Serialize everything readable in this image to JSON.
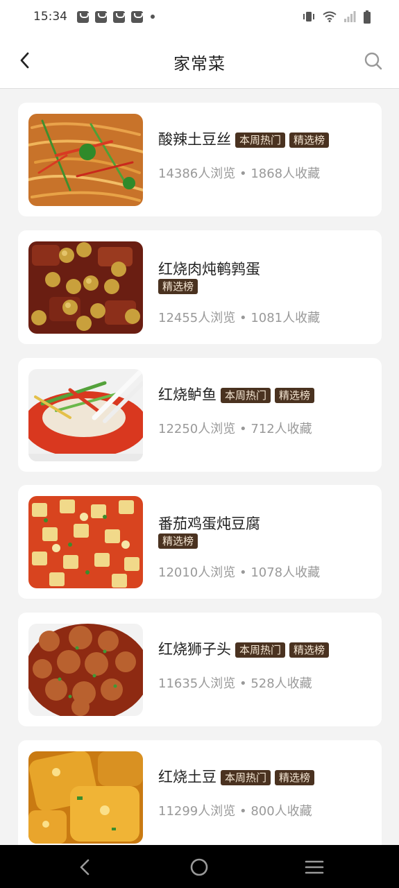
{
  "status_bar": {
    "time": "15:34"
  },
  "header": {
    "title": "家常菜",
    "back_icon": "chevron-left-icon",
    "search_icon": "search-icon"
  },
  "recipes": [
    {
      "name": "酸辣土豆丝",
      "tags": [
        "本周热门",
        "精选榜"
      ],
      "stats": "14386人浏览 • 1868人收藏"
    },
    {
      "name": "红烧肉炖鹌鹑蛋",
      "tags": [
        "精选榜"
      ],
      "stats": "12455人浏览 • 1081人收藏"
    },
    {
      "name": "红烧鲈鱼",
      "tags": [
        "本周热门",
        "精选榜"
      ],
      "stats": "12250人浏览 • 712人收藏"
    },
    {
      "name": "番茄鸡蛋炖豆腐",
      "tags": [
        "精选榜"
      ],
      "stats": "12010人浏览 • 1078人收藏"
    },
    {
      "name": "红烧狮子头",
      "tags": [
        "本周热门",
        "精选榜"
      ],
      "stats": "11635人浏览 • 528人收藏"
    },
    {
      "name": "红烧土豆",
      "tags": [
        "本周热门",
        "精选榜"
      ],
      "stats": "11299人浏览 • 800人收藏"
    }
  ],
  "nav_bar": {
    "back": "triangle-back-icon",
    "home": "circle-home-icon",
    "menu": "menu-icon"
  },
  "colors": {
    "tag_bg": "#4a3220",
    "tag_text": "#f4e6d3",
    "stats_text": "#999999"
  }
}
